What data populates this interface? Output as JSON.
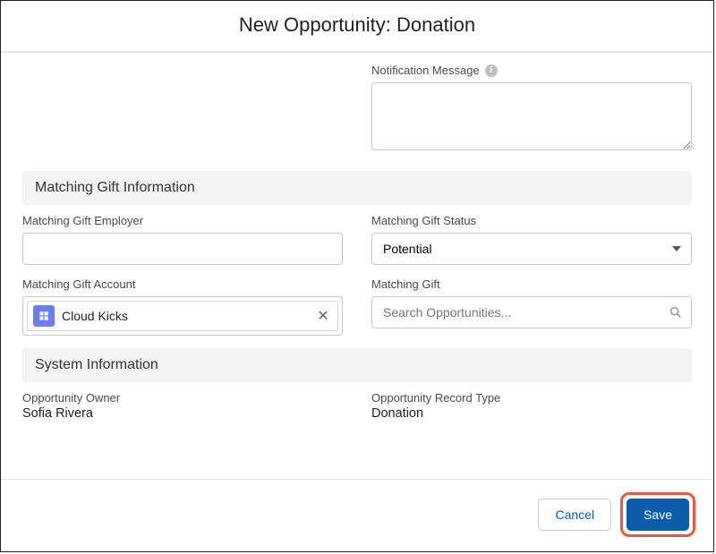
{
  "header": {
    "title": "New Opportunity: Donation"
  },
  "notification": {
    "label": "Notification Message",
    "value": ""
  },
  "sections": {
    "matching": {
      "title": "Matching Gift Information",
      "employer": {
        "label": "Matching Gift Employer",
        "value": ""
      },
      "status": {
        "label": "Matching Gift Status",
        "value": "Potential"
      },
      "account": {
        "label": "Matching Gift Account",
        "pill_text": "Cloud Kicks"
      },
      "gift": {
        "label": "Matching Gift",
        "placeholder": "Search Opportunities..."
      }
    },
    "system": {
      "title": "System Information",
      "owner": {
        "label": "Opportunity Owner",
        "value": "Sofia Rivera"
      },
      "recordType": {
        "label": "Opportunity Record Type",
        "value": "Donation"
      }
    }
  },
  "footer": {
    "cancel_label": "Cancel",
    "save_label": "Save"
  }
}
